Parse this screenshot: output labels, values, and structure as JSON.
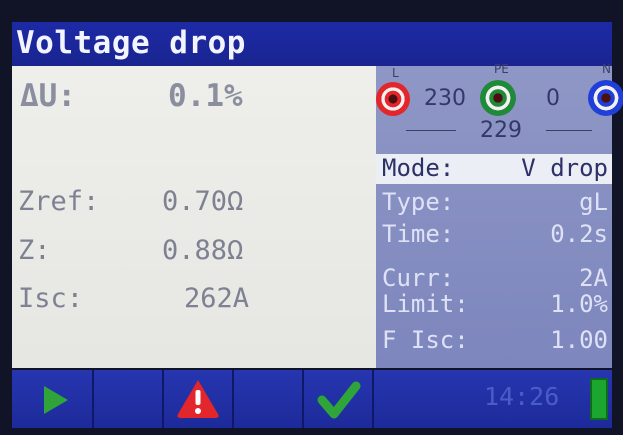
{
  "screen": {
    "title": "Voltage drop"
  },
  "results": {
    "delta_u": {
      "label": "ΔU:",
      "value": "0.1%"
    },
    "zref": {
      "label": "Zref:",
      "value": "0.70Ω"
    },
    "z": {
      "label": "Z:",
      "value": "0.88Ω"
    },
    "isc": {
      "label": "Isc:",
      "value": "262A"
    }
  },
  "terminals": {
    "l": {
      "letter": "L",
      "color": "#e2262b"
    },
    "pe": {
      "letter": "PE",
      "color": "#1f8a3a"
    },
    "n": {
      "letter": "N",
      "color": "#1f3fd8"
    },
    "v_l_pe": "230",
    "v_l_n": "229",
    "v_pe_n": "0"
  },
  "params": {
    "mode": {
      "label": "Mode:",
      "value": "V drop"
    },
    "type": {
      "label": "Type:",
      "value": "gL"
    },
    "time": {
      "label": "Time:",
      "value": "0.2s"
    },
    "curr": {
      "label": "Curr:",
      "value": "2A"
    },
    "limit": {
      "label": "Limit:",
      "value": "1.0%"
    },
    "f_isc": {
      "label": "F Isc:",
      "value": "1.00"
    }
  },
  "softkeys": [
    {
      "icon": "play-icon",
      "color": "#2fa43a"
    },
    {
      "icon": "",
      "color": ""
    },
    {
      "icon": "warning-icon",
      "color": "#e2262b"
    },
    {
      "icon": "",
      "color": ""
    },
    {
      "icon": "check-icon",
      "color": "#2fa43a"
    }
  ],
  "status": {
    "time": "14:26",
    "battery_level": 1.0,
    "battery_color": "#1ca52f"
  }
}
